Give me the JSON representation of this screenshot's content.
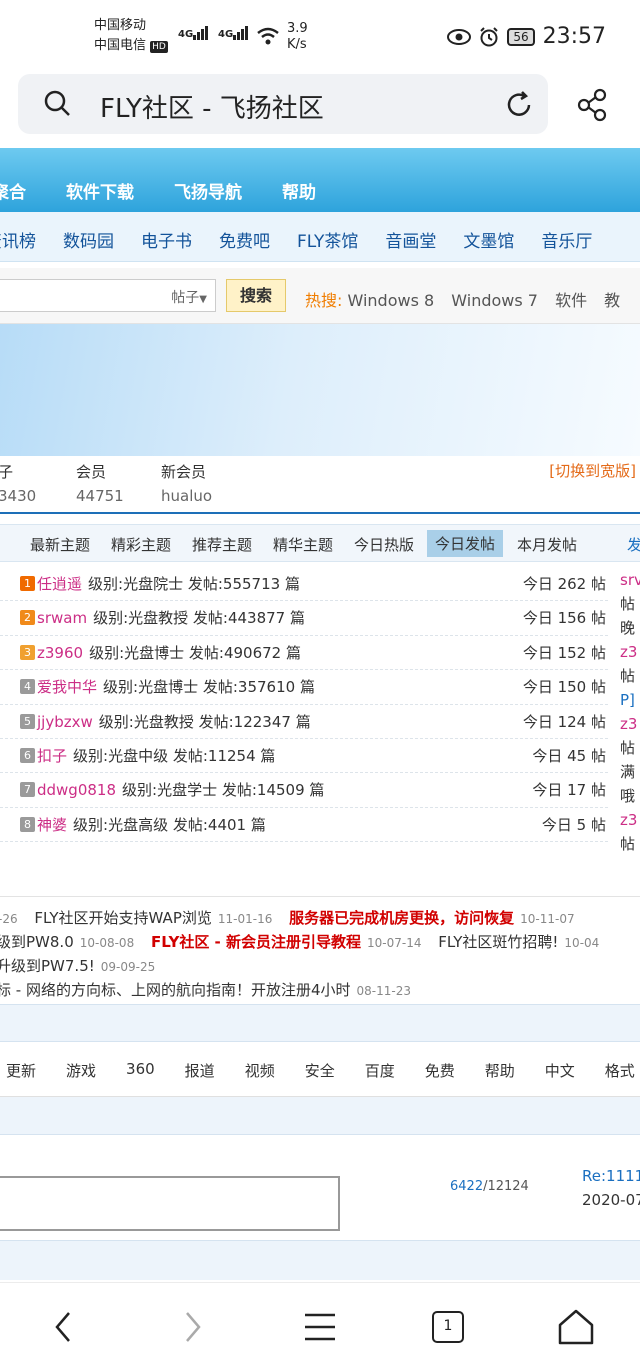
{
  "status_bar": {
    "carrier1": "中国移动",
    "carrier2": "中国电信",
    "hd_badge": "HD",
    "sig1": "4G",
    "sig2": "4G",
    "speed_value": "3.9",
    "speed_unit": "K/s",
    "battery": "56",
    "time": "23:57"
  },
  "browser": {
    "title": "FLY社区 - 飞扬社区",
    "tab_count": "1"
  },
  "nav_primary": [
    "聚合",
    "软件下载",
    "飞扬导航",
    "帮助"
  ],
  "nav_secondary": [
    "资讯榜",
    "数码园",
    "电子书",
    "免费吧",
    "FLY茶馆",
    "音画堂",
    "文墨馆",
    "音乐厅"
  ],
  "search": {
    "type_label": "帖子",
    "button": "搜索",
    "hot_label": "热搜:",
    "hot_terms": [
      "Windows 8",
      "Windows 7",
      "软件",
      "教"
    ]
  },
  "stats": {
    "posts_label": "子",
    "posts_value": "3430",
    "members_label": "会员",
    "members_value": "44751",
    "newmember_label": "新会员",
    "newmember_value": "hualuo",
    "switch_wide": "[切换到宽版]"
  },
  "tabs": {
    "items": [
      "最新主题",
      "精彩主题",
      "推荐主题",
      "精华主题",
      "今日热版",
      "今日发帖",
      "本月发帖"
    ],
    "active": "今日发帖",
    "more": "发"
  },
  "ranking": [
    {
      "rank": "1",
      "name": "任逍遥",
      "level": "级别:光盘院士",
      "posts": "发帖:555713 篇",
      "today": "今日 262 帖",
      "color": "#f06a00"
    },
    {
      "rank": "2",
      "name": "srwam",
      "level": "级别:光盘教授",
      "posts": "发帖:443877 篇",
      "today": "今日 156 帖",
      "color": "#f08a1a"
    },
    {
      "rank": "3",
      "name": "z3960",
      "level": "级别:光盘博士",
      "posts": "发帖:490672 篇",
      "today": "今日 152 帖",
      "color": "#f0a030"
    },
    {
      "rank": "4",
      "name": "爱我中华",
      "level": "级别:光盘博士",
      "posts": "发帖:357610 篇",
      "today": "今日 150 帖",
      "color": "#9a9a9a"
    },
    {
      "rank": "5",
      "name": "jjybzxw",
      "level": "级别:光盘教授",
      "posts": "发帖:122347 篇",
      "today": "今日 124 帖",
      "color": "#9a9a9a"
    },
    {
      "rank": "6",
      "name": "扣子",
      "level": "级别:光盘中级",
      "posts": "发帖:11254 篇",
      "today": "今日 45 帖",
      "color": "#9a9a9a"
    },
    {
      "rank": "7",
      "name": "ddwg0818",
      "level": "级别:光盘学士",
      "posts": "发帖:14509 篇",
      "today": "今日 17 帖",
      "color": "#9a9a9a"
    },
    {
      "rank": "8",
      "name": "神婆",
      "level": "级别:光盘高级",
      "posts": "发帖:4401 篇",
      "today": "今日 5 帖",
      "color": "#9a9a9a"
    }
  ],
  "side_col": [
    "srv",
    "帖",
    "晚",
    "z3",
    "帖",
    "P]",
    "z3",
    "帖",
    "满",
    "哦",
    "z3",
    "帖"
  ],
  "news": {
    "l1a_date": "-26",
    "l1b": "FLY社区开始支持WAP浏览",
    "l1b_date": "11-01-16",
    "l1c": "服务器已完成机房更换，访问恢复",
    "l1c_date": "10-11-07",
    "l2a": "级到PW8.0",
    "l2a_date": "10-08-08",
    "l2b": "FLY社区 - 新会员注册引导教程",
    "l2b_date": "10-07-14",
    "l2c": "FLY社区斑竹招聘!",
    "l2c_date": "10-04",
    "l3a": "升级到PW7.5!",
    "l3a_date": "09-09-25",
    "l4a": "标 - 网络的方向标、上网的航向指南！开放注册4小时",
    "l4a_date": "08-11-23"
  },
  "tags": [
    "更新",
    "游戏",
    "360",
    "报道",
    "视频",
    "安全",
    "百度",
    "免费",
    "帮助",
    "中文",
    "格式"
  ],
  "post": {
    "count_hl": "6422",
    "count_rest": "/12124",
    "re_title": "Re:1111",
    "re_date": "2020-07"
  }
}
